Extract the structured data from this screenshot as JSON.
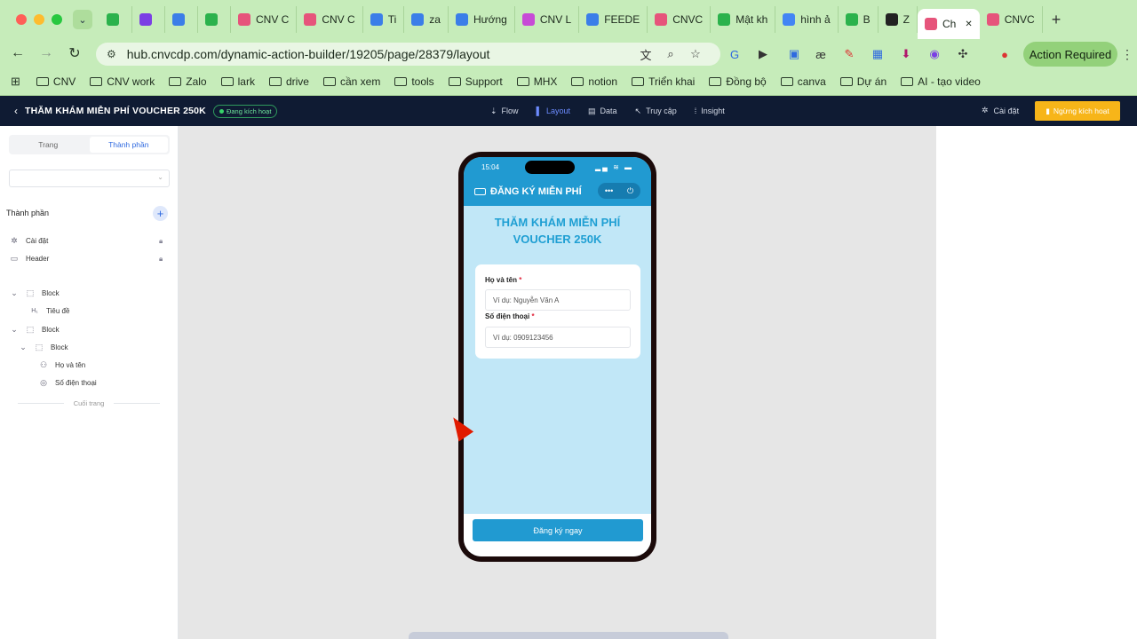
{
  "browser": {
    "tabs": [
      {
        "label": "",
        "color": "#2bb24c"
      },
      {
        "label": "",
        "color": "#7b3fe4"
      },
      {
        "label": "",
        "color": "#3b7ee8"
      },
      {
        "label": "",
        "color": "#2bb24c"
      },
      {
        "label": "CNV C",
        "color": "#e6547b"
      },
      {
        "label": "CNV C",
        "color": "#e6547b"
      },
      {
        "label": "Ti",
        "color": "#3b7ee8"
      },
      {
        "label": "za",
        "color": "#3b7ee8"
      },
      {
        "label": "Hướng",
        "color": "#3b7ee8"
      },
      {
        "label": "CNV L",
        "color": "#c74bd6"
      },
      {
        "label": "FEEDE",
        "color": "#3b7ee8"
      },
      {
        "label": "CNVC",
        "color": "#e6547b"
      },
      {
        "label": "Mật kh",
        "color": "#2bb24c"
      },
      {
        "label": "hình ả",
        "color": "#4285f4"
      },
      {
        "label": "B",
        "color": "#2bb24c"
      },
      {
        "label": "Z",
        "color": "#222222"
      },
      {
        "label": "Ch",
        "color": "#e6547b",
        "active": true
      },
      {
        "label": "CNVC",
        "color": "#e6547b"
      }
    ],
    "url": "hub.cnvcdp.com/dynamic-action-builder/19205/page/28379/layout",
    "action_required": "Action Required",
    "bookmarks": [
      "CNV",
      "CNV work",
      "Zalo",
      "lark",
      "drive",
      "cần xem",
      "tools",
      "Support",
      "MHX",
      "notion",
      "Triển khai",
      "Đồng bộ",
      "canva",
      "Dự án",
      "AI - tạo video"
    ]
  },
  "app": {
    "page_title": "THĂM KHÁM MIỄN PHÍ VOUCHER 250K",
    "status": "Đang kích hoạt",
    "nav": [
      "Flow",
      "Layout",
      "Data",
      "Truy cập",
      "Insight"
    ],
    "settings": "Cài đặt",
    "stop_button": "Ngừng kích hoạt"
  },
  "sidebar": {
    "segments": [
      "Trang",
      "Thành phần"
    ],
    "section_title": "Thành phần",
    "fixed_items": [
      "Cài đặt",
      "Header"
    ],
    "tree": [
      {
        "label": "Block",
        "level": 0,
        "icon": "block"
      },
      {
        "label": "Tiêu đề",
        "level": 1,
        "icon": "heading"
      },
      {
        "label": "Block",
        "level": 0,
        "icon": "block"
      },
      {
        "label": "Block",
        "level": 1,
        "icon": "block"
      },
      {
        "label": "Họ và tên",
        "level": 2,
        "icon": "user"
      },
      {
        "label": "Số điện thoại",
        "level": 2,
        "icon": "phone"
      }
    ],
    "footer": "Cuối trang"
  },
  "phone": {
    "time": "15:04",
    "header_title": "ĐĂNG KÝ MIỄN PHÍ",
    "heading_line1": "THĂM KHÁM MIỄN PHÍ",
    "heading_line2": "VOUCHER 250K",
    "fields": [
      {
        "label": "Họ và tên",
        "required": "*",
        "placeholder": "Ví dụ: Nguyễn Văn A"
      },
      {
        "label": "Số điện thoại",
        "required": "*",
        "placeholder": "Ví dụ: 0909123456"
      }
    ],
    "cta": "Đăng ký ngay",
    "colors": {
      "primary": "#219ad1",
      "background": "#c1e7f7"
    }
  }
}
